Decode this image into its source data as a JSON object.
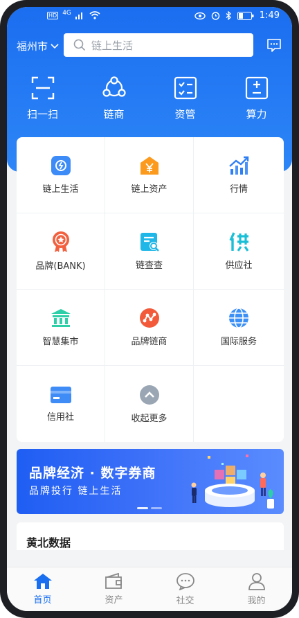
{
  "status_bar": {
    "badge": "HD",
    "signal": "4G",
    "time": "1:49"
  },
  "header": {
    "city": "福州市",
    "search_placeholder": "链上生活"
  },
  "quick_actions": [
    {
      "label": "扫一扫",
      "icon": "scan-icon"
    },
    {
      "label": "链商",
      "icon": "chain-merchant-icon"
    },
    {
      "label": "资管",
      "icon": "asset-manage-icon"
    },
    {
      "label": "算力",
      "icon": "compute-power-icon"
    }
  ],
  "grid_items": [
    {
      "label": "链上生活",
      "icon": "chain-life-icon"
    },
    {
      "label": "链上资产",
      "icon": "chain-asset-icon"
    },
    {
      "label": "行情",
      "icon": "market-trend-icon"
    },
    {
      "label": "品牌(BANK)",
      "icon": "brand-badge-icon"
    },
    {
      "label": "链查查",
      "icon": "chain-query-icon"
    },
    {
      "label": "供应社",
      "icon": "supply-icon"
    },
    {
      "label": "智慧集市",
      "icon": "market-building-icon"
    },
    {
      "label": "品牌链商",
      "icon": "brand-chain-icon"
    },
    {
      "label": "国际服务",
      "icon": "globe-icon"
    },
    {
      "label": "信用社",
      "icon": "credit-card-icon"
    },
    {
      "label": "收起更多",
      "icon": "collapse-up-icon"
    }
  ],
  "banner": {
    "title": "品牌经济 · 数字券商",
    "subtitle": "品牌投行 链上生活"
  },
  "section": {
    "title": "黄北数据"
  },
  "tabbar": [
    {
      "label": "首页",
      "icon": "home-icon",
      "active": true
    },
    {
      "label": "资产",
      "icon": "wallet-icon",
      "active": false
    },
    {
      "label": "社交",
      "icon": "chat-icon",
      "active": false
    },
    {
      "label": "我的",
      "icon": "profile-icon",
      "active": false
    }
  ],
  "colors": {
    "primary": "#1a6ff0",
    "header_bg": "#2d86f7"
  }
}
